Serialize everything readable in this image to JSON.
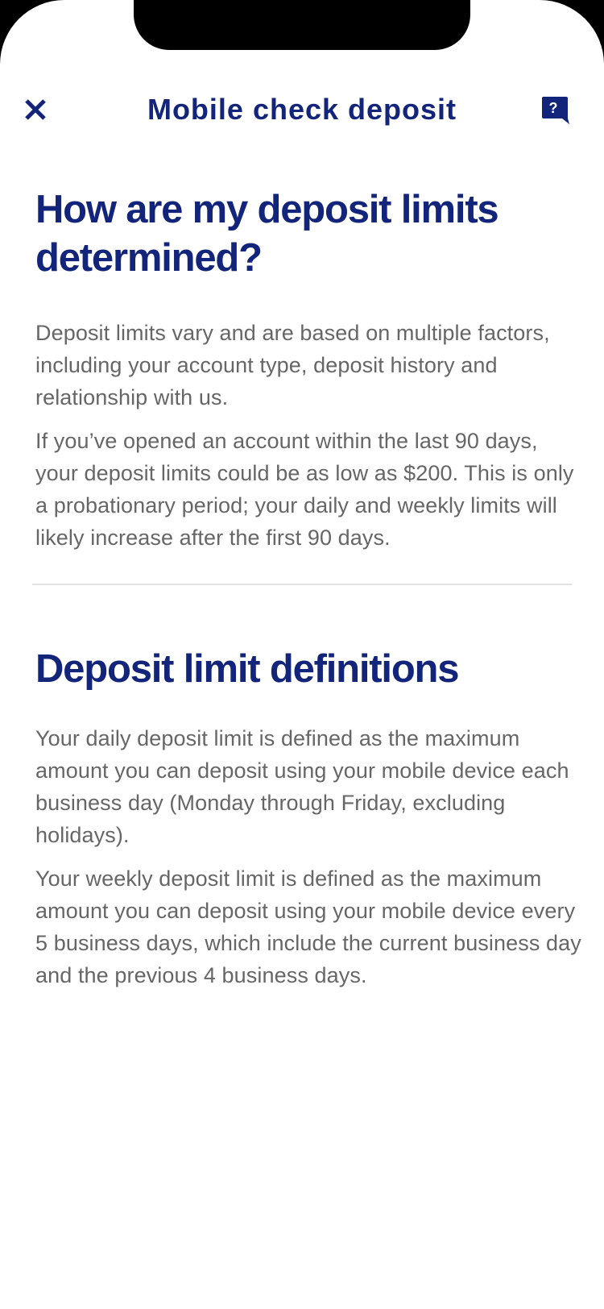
{
  "header": {
    "title": "Mobile check deposit",
    "close_icon": "close-icon",
    "help_icon": "help-chat-icon",
    "help_glyph": "?"
  },
  "colors": {
    "brand_navy": "#13257a",
    "body_text": "#666666",
    "divider": "#e2e2e2"
  },
  "section1": {
    "heading": "How are my deposit limits determined?",
    "paragraphs": [
      "Deposit limits vary and are based on multiple factors, including your account type, deposit history and relationship with us.",
      "If you’ve opened an account within the last 90 days, your deposit limits could be as low as $200. This is only a probationary period; your daily and weekly limits will likely increase after the first 90 days."
    ]
  },
  "section2": {
    "heading": "Deposit limit definitions",
    "paragraphs": [
      "Your daily deposit limit is defined as the maximum amount you can deposit using your mobile device each business day (Monday through Friday, excluding holidays).",
      "Your weekly deposit limit is defined as the maximum amount you can deposit using your mobile device every 5 business days, which include the current business day and the previous 4 business days."
    ]
  }
}
